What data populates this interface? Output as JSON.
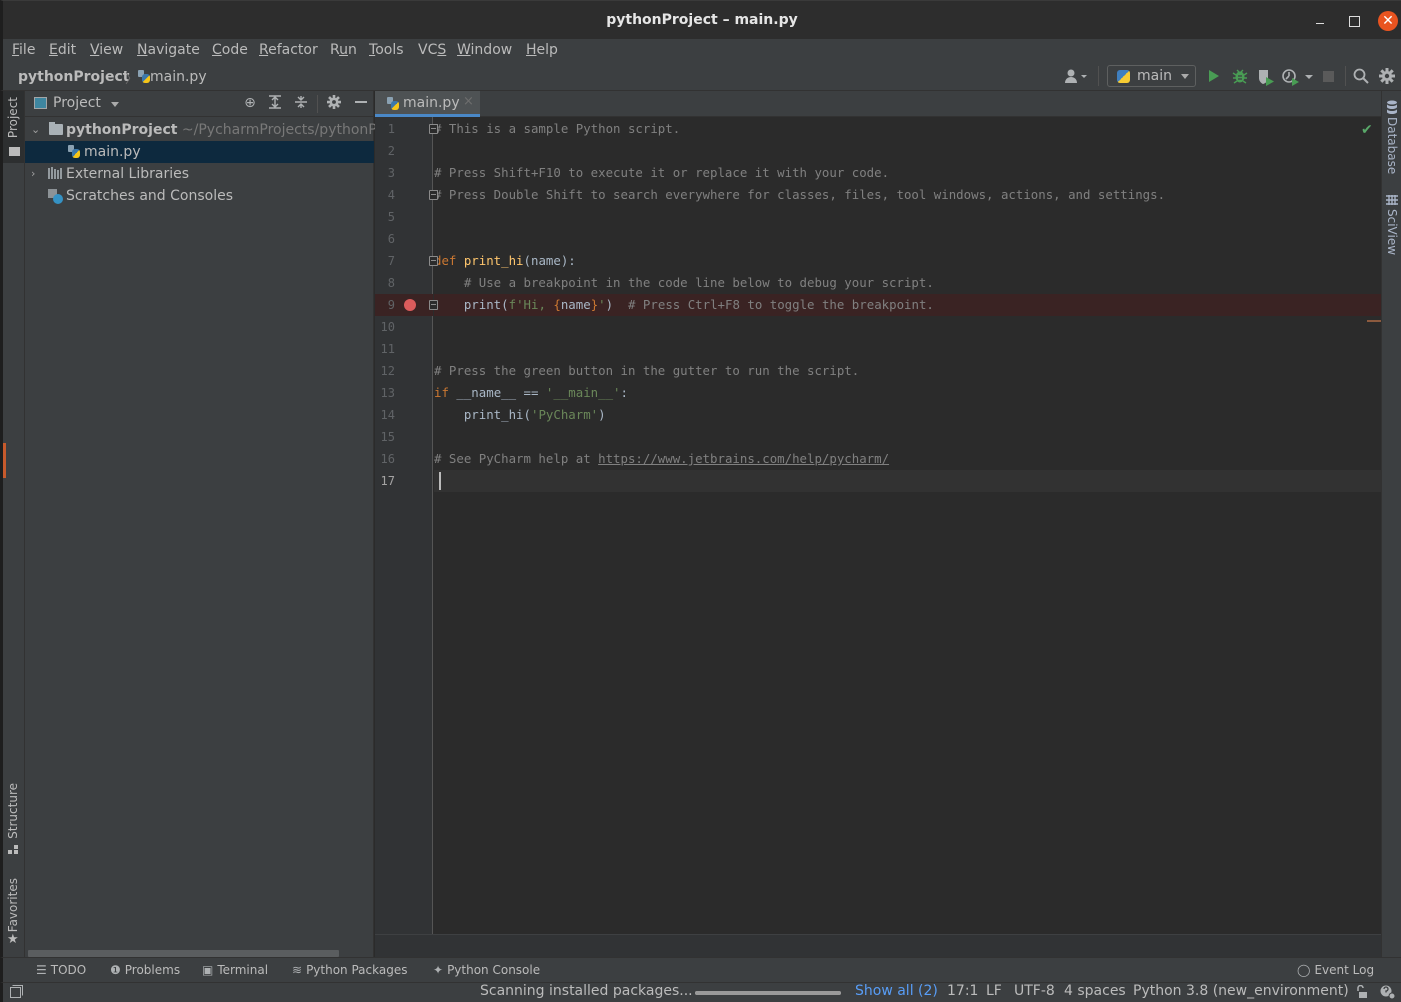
{
  "window": {
    "title": "pythonProject – main.py",
    "close_glyph": "✕"
  },
  "menu": [
    "File",
    "Edit",
    "View",
    "Navigate",
    "Code",
    "Refactor",
    "Run",
    "Tools",
    "VCS",
    "Window",
    "Help"
  ],
  "menu_mnemonics": [
    "F",
    "E",
    "V",
    "N",
    "C",
    "R",
    "u",
    "T",
    "S",
    "W",
    "H"
  ],
  "breadcrumb": {
    "project": "pythonProject",
    "separator": "〉",
    "file": "main.py"
  },
  "toolbar": {
    "run_config": "main",
    "icons": [
      "user-icon",
      "run-icon",
      "debug-icon",
      "coverage-icon",
      "profile-icon",
      "stop-icon",
      "search-icon",
      "settings-icon"
    ]
  },
  "left_stripe": {
    "tabs": [
      "Project",
      "Structure",
      "Favorites"
    ]
  },
  "right_stripe": {
    "tabs": [
      "Database",
      "SciView"
    ]
  },
  "project_panel": {
    "title": "Project",
    "tree": [
      {
        "label": "pythonProject",
        "path": "~/PycharmProjects/pythonPr",
        "type": "folder",
        "expanded": true
      },
      {
        "label": "main.py",
        "type": "python-file",
        "selected": true
      },
      {
        "label": "External Libraries",
        "type": "library",
        "expanded": false
      },
      {
        "label": "Scratches and Consoles",
        "type": "scratches"
      }
    ]
  },
  "editor": {
    "tab_label": "main.py",
    "close_glyph": "×",
    "current_line": 17,
    "breakpoint_line": 9,
    "line_numbers": [
      "1",
      "2",
      "3",
      "4",
      "5",
      "6",
      "7",
      "8",
      "9",
      "10",
      "11",
      "12",
      "13",
      "14",
      "15",
      "16",
      "17"
    ],
    "lines": {
      "l1": "# This is a sample Python script.",
      "l3": "# Press Shift+F10 to execute it or replace it with your code.",
      "l4": "# Press Double Shift to search everywhere for classes, files, tool windows, actions, and settings.",
      "l7_kw": "def ",
      "l7_fn": "print_hi",
      "l7_rest": "(name):",
      "l8": "    # Use a breakpoint in the code line below to debug your script.",
      "l9_a": "    print(",
      "l9_str1": "f'Hi, ",
      "l9_brace1": "{",
      "l9_name": "name",
      "l9_brace2": "}",
      "l9_str2": "'",
      "l9_b": ")  ",
      "l9_com": "# Press Ctrl+F8 to toggle the breakpoint.",
      "l12": "# Press the green button in the gutter to run the script.",
      "l13_kw": "if ",
      "l13_a": "__name__ == ",
      "l13_str": "'__main__'",
      "l13_b": ":",
      "l14_a": "    print_hi(",
      "l14_str": "'PyCharm'",
      "l14_b": ")",
      "l16_com": "# See PyCharm help at ",
      "l16_link": "https://www.jetbrains.com/help/pycharm/"
    }
  },
  "bottom_tools": [
    {
      "icon": "☰",
      "label": "TODO"
    },
    {
      "icon": "❶",
      "label": "Problems"
    },
    {
      "icon": "▣",
      "label": "Terminal"
    },
    {
      "icon": "≋",
      "label": "Python Packages"
    },
    {
      "icon": "✦",
      "label": "Python Console"
    }
  ],
  "event_log": "Event Log",
  "status": {
    "task": "Scanning installed packages...",
    "progress": 1.0,
    "show_all": "Show all (2)",
    "position": "17:1",
    "line_sep": "LF",
    "encoding": "UTF-8",
    "indent": "4 spaces",
    "interpreter": "Python 3.8 (new_environment)"
  }
}
